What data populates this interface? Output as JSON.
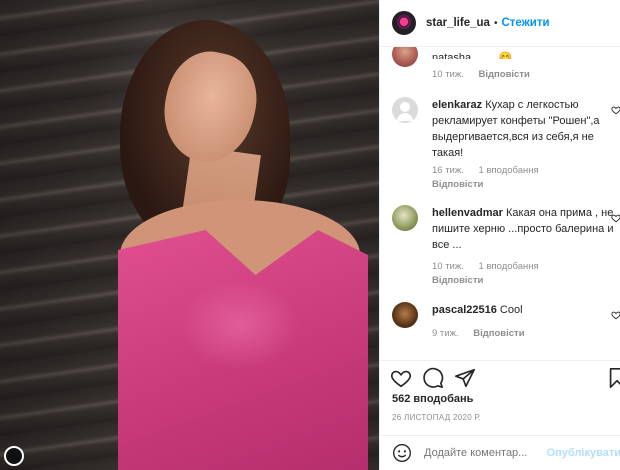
{
  "post": {
    "photo_alt": "",
    "username": "star_life_ua",
    "dot": "•",
    "follow": "Стежити"
  },
  "comments": {
    "cut_text": "natasha........ 😊",
    "top_meta": {
      "time": "10 тиж.",
      "reply": "Відповісти"
    },
    "items": [
      {
        "user": "elenkaraz",
        "text": "Кухар с легкостью рекламирует конфеты \"Рошен\",а выдергивается,вся из себя,я не такая!",
        "time": "16 тиж.",
        "likes": "1 вподобання",
        "reply": "Відповісти"
      },
      {
        "user": "hellenvadmar",
        "text": "Какая она прима , не пишите херню ...просто балерина и все ...",
        "time": "10 тиж.",
        "likes": "1 вподобання",
        "reply": "Відповісти"
      },
      {
        "user": "pascal22516",
        "text": "Cool",
        "time": "9 тиж.",
        "reply": "Відповісти"
      }
    ]
  },
  "engagement": {
    "likes": "562 вподобань",
    "date": "26 ЛИСТОПАД 2020 Р."
  },
  "add_comment": {
    "placeholder": "Додайте коментар...",
    "publish": "Опублікувати"
  },
  "icons": {
    "like": "heart-icon",
    "comment": "comment-icon",
    "share": "share-icon",
    "save": "bookmark-icon",
    "emoji": "emoji-icon",
    "comment_like": "small-heart-icon"
  }
}
